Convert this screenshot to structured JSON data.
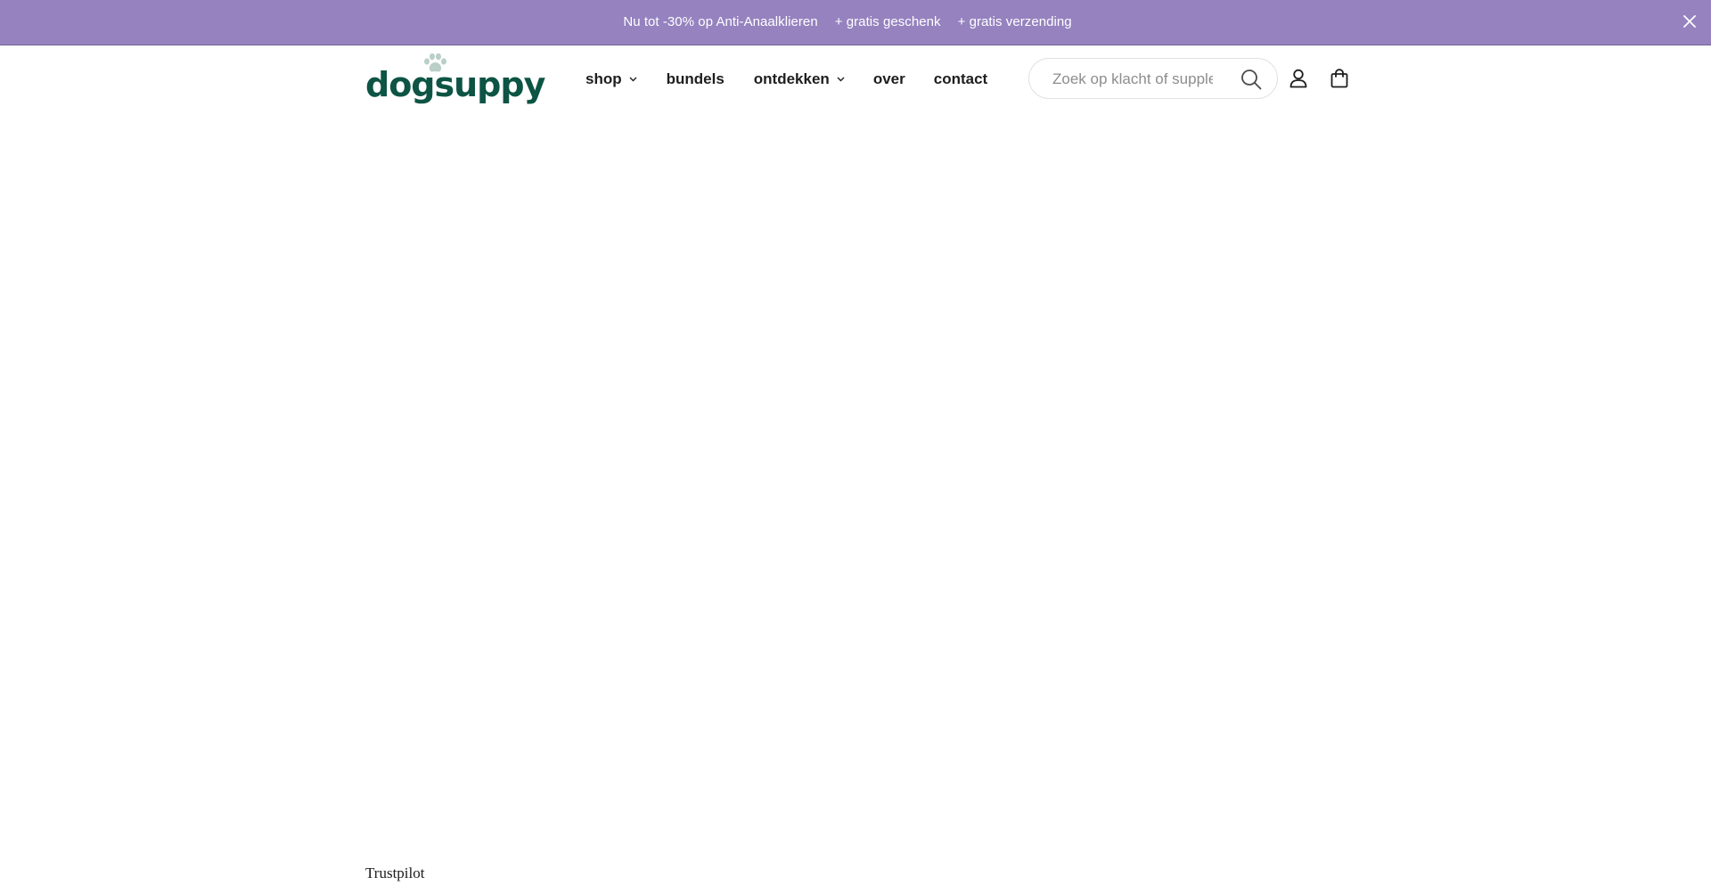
{
  "announcement": {
    "messages": [
      "Nu tot -30% op Anti-Anaalklieren",
      "+ gratis geschenk",
      "+ gratis verzending"
    ],
    "background_color": "#9582bf",
    "close_icon": "close-icon"
  },
  "header": {
    "logo_text": "dogsuppy",
    "logo_color": "#0d5444",
    "logo_icon": "paw-icon",
    "nav": [
      {
        "label": "shop",
        "has_dropdown": true
      },
      {
        "label": "bundels",
        "has_dropdown": false
      },
      {
        "label": "ontdekken",
        "has_dropdown": true
      },
      {
        "label": "over",
        "has_dropdown": false
      },
      {
        "label": "contact",
        "has_dropdown": false
      }
    ],
    "search": {
      "placeholder": "Zoek op klacht of supplement",
      "value": "",
      "icon": "search-icon"
    },
    "account_icon": "user-icon",
    "cart_icon": "shopping-bag-icon"
  },
  "footer_widget": {
    "trustpilot_label": "Trustpilot"
  }
}
